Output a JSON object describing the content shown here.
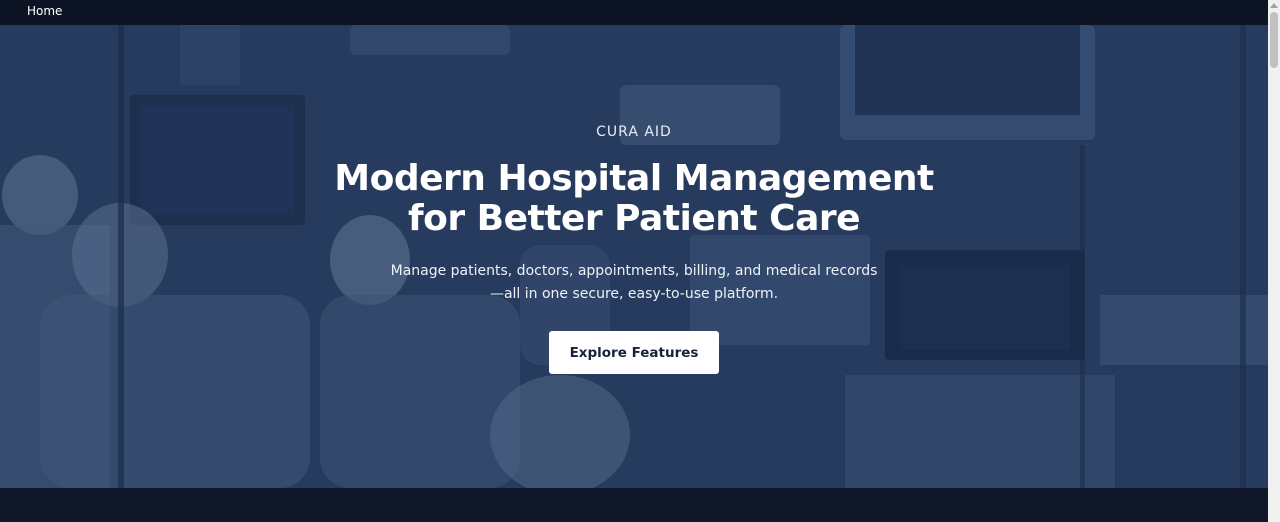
{
  "nav": {
    "home_label": "Home"
  },
  "hero": {
    "eyebrow": "CURA AID",
    "headline_line1": "Modern Hospital Management",
    "headline_line2": "for Better Patient Care",
    "subtitle_line1": "Manage patients, doctors, appointments, billing, and medical records",
    "subtitle_line2": "—all in one secure, easy-to-use platform.",
    "cta_label": "Explore Features"
  },
  "colors": {
    "page_bg": "#0f1728",
    "topbar_bg": "#0d1424",
    "hero_tint": "#2a3f60",
    "cta_bg": "#ffffff",
    "cta_text": "#15233b"
  }
}
